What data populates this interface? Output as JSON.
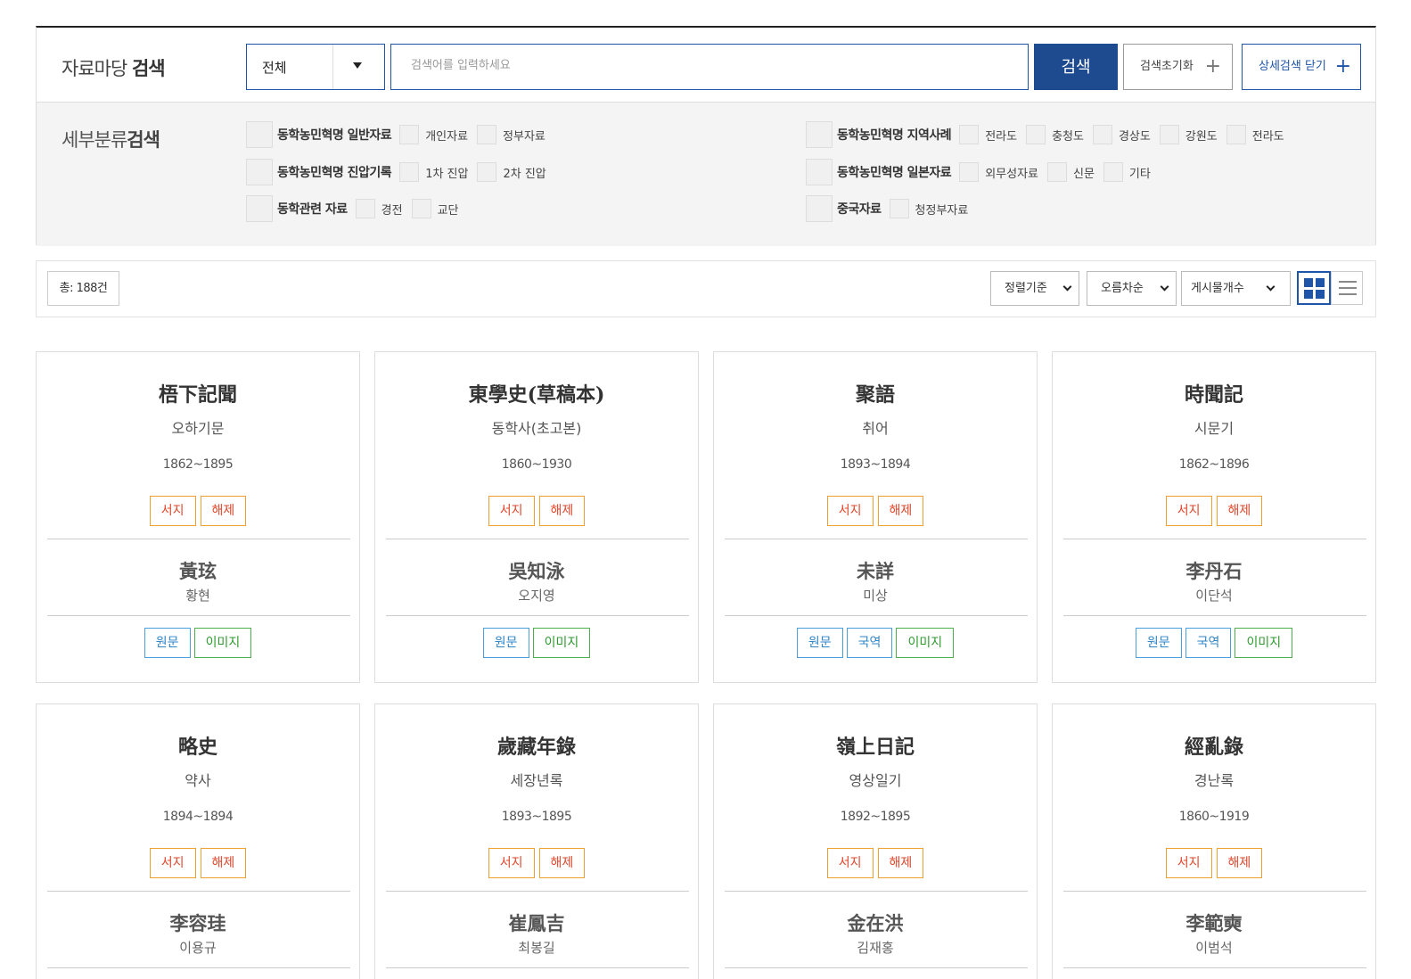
{
  "search": {
    "title_prefix": "자료마당 ",
    "title_bold": "검색",
    "scope_value": "전체",
    "placeholder": "검색어를 입력하세요",
    "search_label": "검색",
    "reset_label": "검색초기화",
    "detail_label": "상세검색 닫기",
    "plus": "+"
  },
  "filters": {
    "title_prefix": "세부분류",
    "title_bold": "검색",
    "left": [
      {
        "label": "동학농민혁명 일반자료",
        "subs": [
          "개인자료",
          "정부자료"
        ]
      },
      {
        "label": "동학농민혁명 진압기록",
        "subs": [
          "1차 진압",
          "2차 진압"
        ]
      },
      {
        "label": "동학관련 자료",
        "subs": [
          "경전",
          "교단"
        ]
      }
    ],
    "right": [
      {
        "label": "동학농민혁명 지역사례",
        "subs": [
          "전라도",
          "충청도",
          "경상도",
          "강원도",
          "전라도"
        ]
      },
      {
        "label": "동학농민혁명 일본자료",
        "subs": [
          "외무성자료",
          "신문",
          "기타"
        ]
      },
      {
        "label": "중국자료",
        "subs": [
          "청정부자료"
        ]
      }
    ]
  },
  "result_bar": {
    "total": "총: 188건",
    "sort_label": "정렬기준",
    "order_label": "오름차순",
    "count_label": "게시물개수"
  },
  "cards": [
    {
      "title": "梧下記聞",
      "kor": "오하기문",
      "years": "1862~1895",
      "tags": [
        "서지",
        "해제"
      ],
      "author": "黃玹",
      "author_kor": "황현",
      "actions": [
        {
          "label": "원문",
          "color": "blue"
        },
        {
          "label": "이미지",
          "color": "green"
        }
      ]
    },
    {
      "title": "東學史(草稿本)",
      "kor": "동학사(초고본)",
      "years": "1860~1930",
      "tags": [
        "서지",
        "해제"
      ],
      "author": "吳知泳",
      "author_kor": "오지영",
      "actions": [
        {
          "label": "원문",
          "color": "blue"
        },
        {
          "label": "이미지",
          "color": "green"
        }
      ]
    },
    {
      "title": "聚語",
      "kor": "취어",
      "years": "1893~1894",
      "tags": [
        "서지",
        "해제"
      ],
      "author": "未詳",
      "author_kor": "미상",
      "actions": [
        {
          "label": "원문",
          "color": "blue"
        },
        {
          "label": "국역",
          "color": "blue"
        },
        {
          "label": "이미지",
          "color": "green"
        }
      ]
    },
    {
      "title": "時聞記",
      "kor": "시문기",
      "years": "1862~1896",
      "tags": [
        "서지",
        "해제"
      ],
      "author": "李丹石",
      "author_kor": "이단석",
      "actions": [
        {
          "label": "원문",
          "color": "blue"
        },
        {
          "label": "국역",
          "color": "blue"
        },
        {
          "label": "이미지",
          "color": "green"
        }
      ]
    },
    {
      "title": "略史",
      "kor": "약사",
      "years": "1894~1894",
      "tags": [
        "서지",
        "해제"
      ],
      "author": "李容珪",
      "author_kor": "이용규",
      "actions": []
    },
    {
      "title": "歲藏年錄",
      "kor": "세장년록",
      "years": "1893~1895",
      "tags": [
        "서지",
        "해제"
      ],
      "author": "崔鳳吉",
      "author_kor": "최봉길",
      "actions": []
    },
    {
      "title": "嶺上日記",
      "kor": "영상일기",
      "years": "1892~1895",
      "tags": [
        "서지",
        "해제"
      ],
      "author": "金在洪",
      "author_kor": "김재홍",
      "actions": []
    },
    {
      "title": "經亂錄",
      "kor": "경난록",
      "years": "1860~1919",
      "tags": [
        "서지",
        "해제"
      ],
      "author": "李範奭",
      "author_kor": "이범석",
      "actions": []
    }
  ]
}
